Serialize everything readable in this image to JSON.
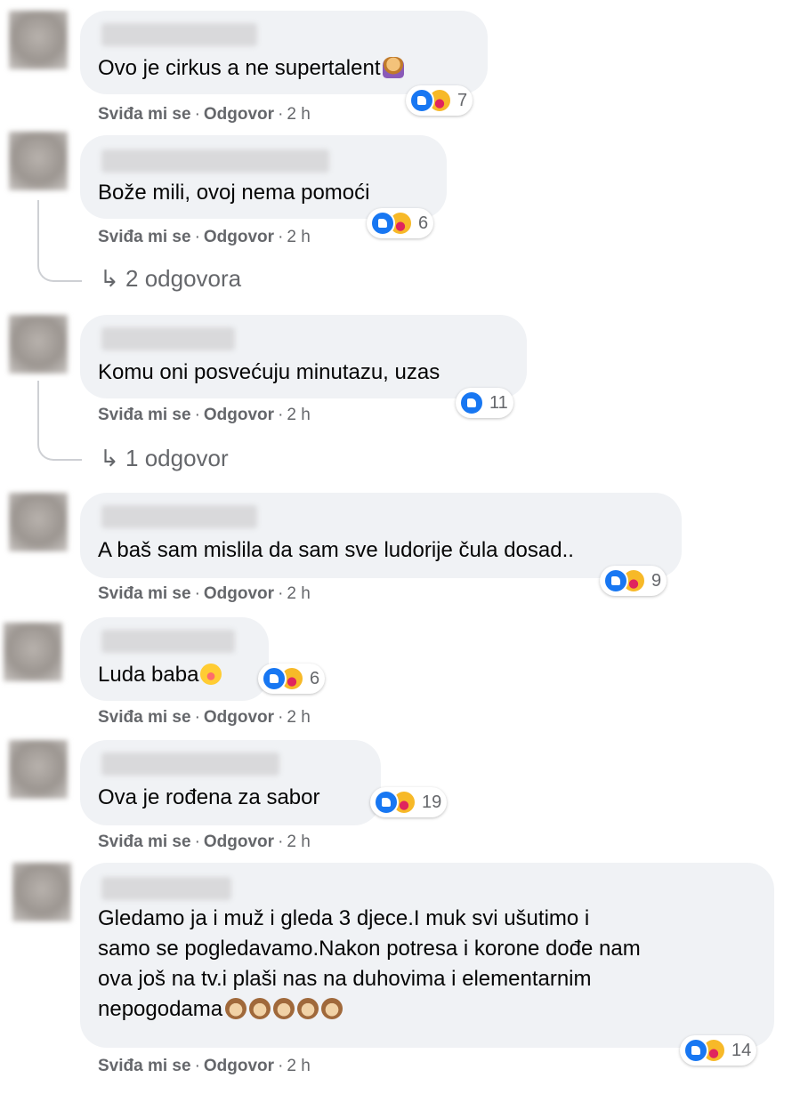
{
  "actions": {
    "like": "Sviđa mi se",
    "reply": "Odgovor",
    "separator": "·",
    "time": "2 h"
  },
  "comments": [
    {
      "text": "Ovo je cirkus a ne supertalent",
      "emoji": "woman-facepalming",
      "reactions": [
        "like",
        "haha"
      ],
      "count": "7"
    },
    {
      "text": "Bože mili, ovoj nema pomoći",
      "reactions": [
        "like",
        "haha"
      ],
      "count": "6",
      "replies": "2 odgovora"
    },
    {
      "text": "Komu oni posvećuju minutazu, uzas",
      "reactions": [
        "like"
      ],
      "count": "11",
      "replies": "1 odgovor"
    },
    {
      "text": "A baš sam mislila da sam sve ludorije čula dosad..",
      "reactions": [
        "like",
        "haha"
      ],
      "count": "9"
    },
    {
      "text": "Luda baba",
      "emoji": "face-with-tears-of-joy",
      "reactions": [
        "like",
        "haha"
      ],
      "count": "6"
    },
    {
      "text": "Ova je rođena za sabor",
      "reactions": [
        "like",
        "haha"
      ],
      "count": "19"
    },
    {
      "text_lines": [
        "Gledamo ja i muž i gleda 3 djece.I muk svi ušutimo i",
        "samo se pogledavamo.Nakon potresa i korone dođe nam",
        "ova još na tv.i plaši nas na duhovima i elementarnim",
        "nepogodama"
      ],
      "emoji": "see-no-evil-monkey",
      "reactions": [
        "like",
        "haha"
      ],
      "count": "14"
    }
  ],
  "colors": {
    "bubble": "#f0f2f5",
    "like": "#1877f2",
    "haha": "#f7b928",
    "secondary_text": "#65676b"
  }
}
